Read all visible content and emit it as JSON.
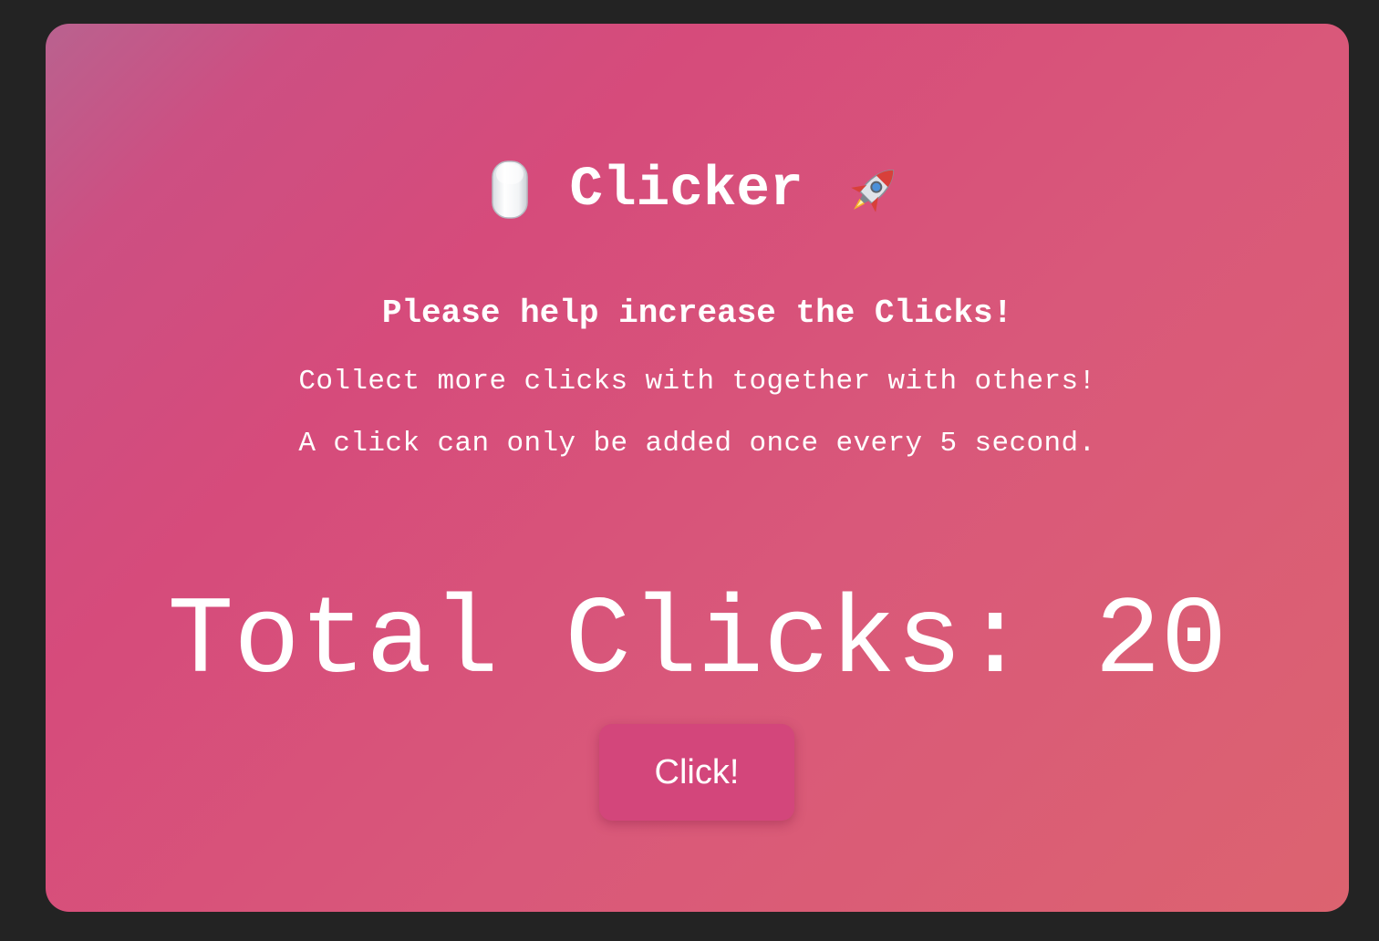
{
  "header": {
    "title": "Clicker",
    "left_icon": "computer-mouse-icon",
    "right_icon": "rocket-icon"
  },
  "subtitle": "Please help increase the Clicks!",
  "description": [
    "Collect more clicks with together with others!",
    "A click can only be added once every 5 second."
  ],
  "counter": {
    "text": "Total Clicks: 20",
    "value": 20
  },
  "button": {
    "label": "Click!"
  },
  "colors": {
    "page_background": "#232323",
    "button_background": "#d3467b",
    "text": "#ffffff"
  }
}
